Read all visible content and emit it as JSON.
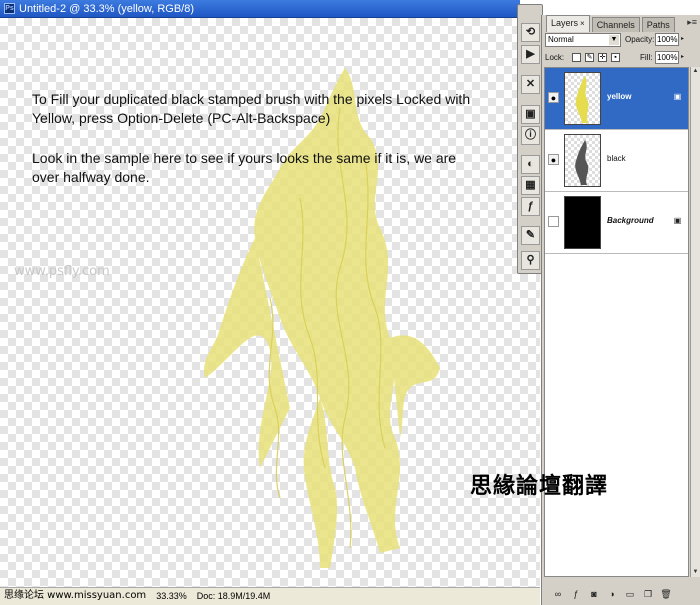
{
  "document": {
    "title": "Untitled-2 @ 33.3% (yellow, RGB/8)",
    "app_icon": "Ps",
    "status_zoom": "33.33%",
    "status_info": "Doc: 18.9M/19.4M",
    "status_site": "思缘论坛  www.missyuan.com"
  },
  "instructions": {
    "para1": "To Fill your duplicated black stamped brush with the pixels Locked with Yellow, press Option-Delete (PC-Alt-Backspace)",
    "para2": "Look in the sample here to see if yours looks the same if it is, we are over halfway done.",
    "canvas_watermark": "www.psfly.com"
  },
  "overlay_watermark": "思緣論壇翻譯",
  "colors": {
    "titlebar": "#1f57c4",
    "selection": "#316ac5",
    "brush_yellow": "#e6e07a"
  },
  "toolstrip": {
    "icons": [
      "history-icon",
      "actions-icon",
      "tools-icon",
      "navigator-icon",
      "info-icon",
      "color-icon",
      "swatches-icon",
      "styles-icon",
      "brushes-icon",
      "clone-source-icon"
    ]
  },
  "layers_panel": {
    "tabs": [
      {
        "label": "Layers",
        "active": true,
        "close": "×"
      },
      {
        "label": "Channels",
        "active": false,
        "close": ""
      },
      {
        "label": "Paths",
        "active": false,
        "close": ""
      }
    ],
    "menu_glyph": "▸≡",
    "blend_mode": "Normal",
    "opacity_label": "Opacity:",
    "opacity_value": "100%",
    "lock_label": "Lock:",
    "fill_label": "Fill:",
    "fill_value": "100%",
    "layers": [
      {
        "name": "yellow",
        "visible": true,
        "selected": true,
        "thumb": "yellow-brush"
      },
      {
        "name": "black",
        "visible": true,
        "selected": false,
        "thumb": "black-brush"
      },
      {
        "name": "Background",
        "visible": false,
        "selected": false,
        "thumb": "solid-black",
        "locked": true
      }
    ],
    "footer_icons": [
      "link-icon",
      "fx-icon",
      "mask-icon",
      "adjustment-icon",
      "group-icon",
      "new-layer-icon",
      "trash-icon"
    ]
  }
}
